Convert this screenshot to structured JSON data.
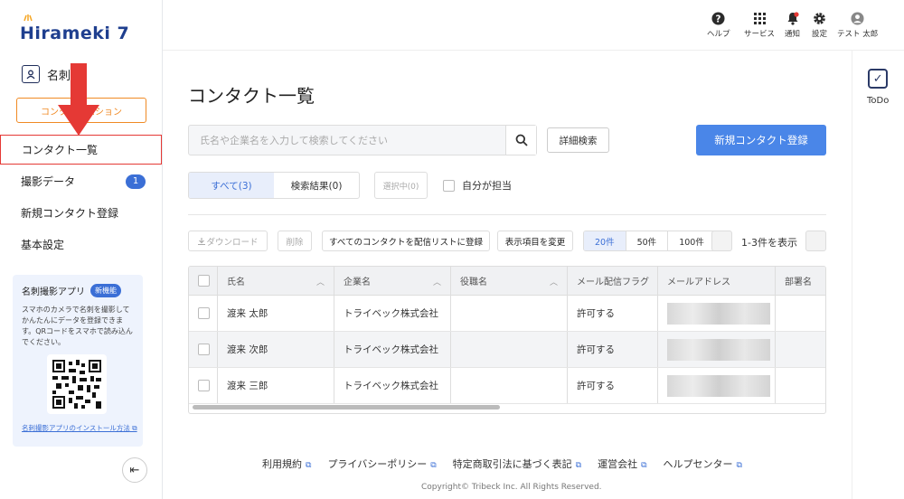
{
  "brand": {
    "name": "Hirameki 7"
  },
  "sidebar": {
    "section_title": "名刺",
    "orange_button": "コンタクト…ション",
    "items": [
      {
        "label": "コンタクト一覧"
      },
      {
        "label": "撮影データ",
        "badge": "1"
      },
      {
        "label": "新規コンタクト登録"
      },
      {
        "label": "基本設定"
      }
    ],
    "app_promo": {
      "title": "名刺撮影アプリ",
      "badge": "新機能",
      "description": "スマホのカメラで名刺を撮影してかんたんにデータを登録できます。QRコードをスマホで読み込んでください。",
      "link": "名刺撮影アプリのインストール方法"
    },
    "collapse_symbol": "⇤"
  },
  "header": {
    "icons": [
      {
        "label": "ヘルプ",
        "icon": "help-icon"
      },
      {
        "label": "サービス",
        "icon": "grid-icon"
      },
      {
        "label": "通知",
        "icon": "bell-icon"
      },
      {
        "label": "設定",
        "icon": "gear-icon"
      },
      {
        "label": "テスト 太郎",
        "icon": "user-icon"
      }
    ]
  },
  "todo": {
    "label": "ToDo"
  },
  "main": {
    "title": "コンタクト一覧",
    "search_placeholder": "氏名や企業名を入力して検索してください",
    "detail_search": "詳細検索",
    "new_contact": "新規コンタクト登録",
    "tabs": [
      {
        "label": "すべて(3)"
      },
      {
        "label": "検索結果(0)"
      }
    ],
    "selected": "選択中(0)",
    "mine_label": "自分が担当",
    "toolbar": {
      "download": "ダウンロード",
      "delete": "削除",
      "register_all": "すべてのコンタクトを配信リストに登録",
      "change_columns": "表示項目を変更",
      "page_sizes": [
        "20件",
        "50件",
        "100件"
      ],
      "range": "1-3件を表示"
    },
    "table": {
      "columns": [
        "氏名",
        "企業名",
        "役職名",
        "メール配信フラグ",
        "メールアドレス",
        "部署名"
      ],
      "rows": [
        {
          "name": "渡来 太郎",
          "company": "トライベック株式会社",
          "title": "",
          "flag": "許可する"
        },
        {
          "name": "渡来 次郎",
          "company": "トライベック株式会社",
          "title": "",
          "flag": "許可する"
        },
        {
          "name": "渡来 三郎",
          "company": "トライベック株式会社",
          "title": "",
          "flag": "許可する"
        }
      ]
    }
  },
  "footer": {
    "links": [
      "利用規約",
      "プライバシーポリシー",
      "特定商取引法に基づく表記",
      "運営会社",
      "ヘルプセンター"
    ],
    "copyright": "Copyright© Tribeck Inc. All Rights Reserved."
  },
  "colors": {
    "brand": "#1f3f8f",
    "accent": "#4a86e8",
    "orange": "#f08a24",
    "highlight_red": "#e53935"
  }
}
